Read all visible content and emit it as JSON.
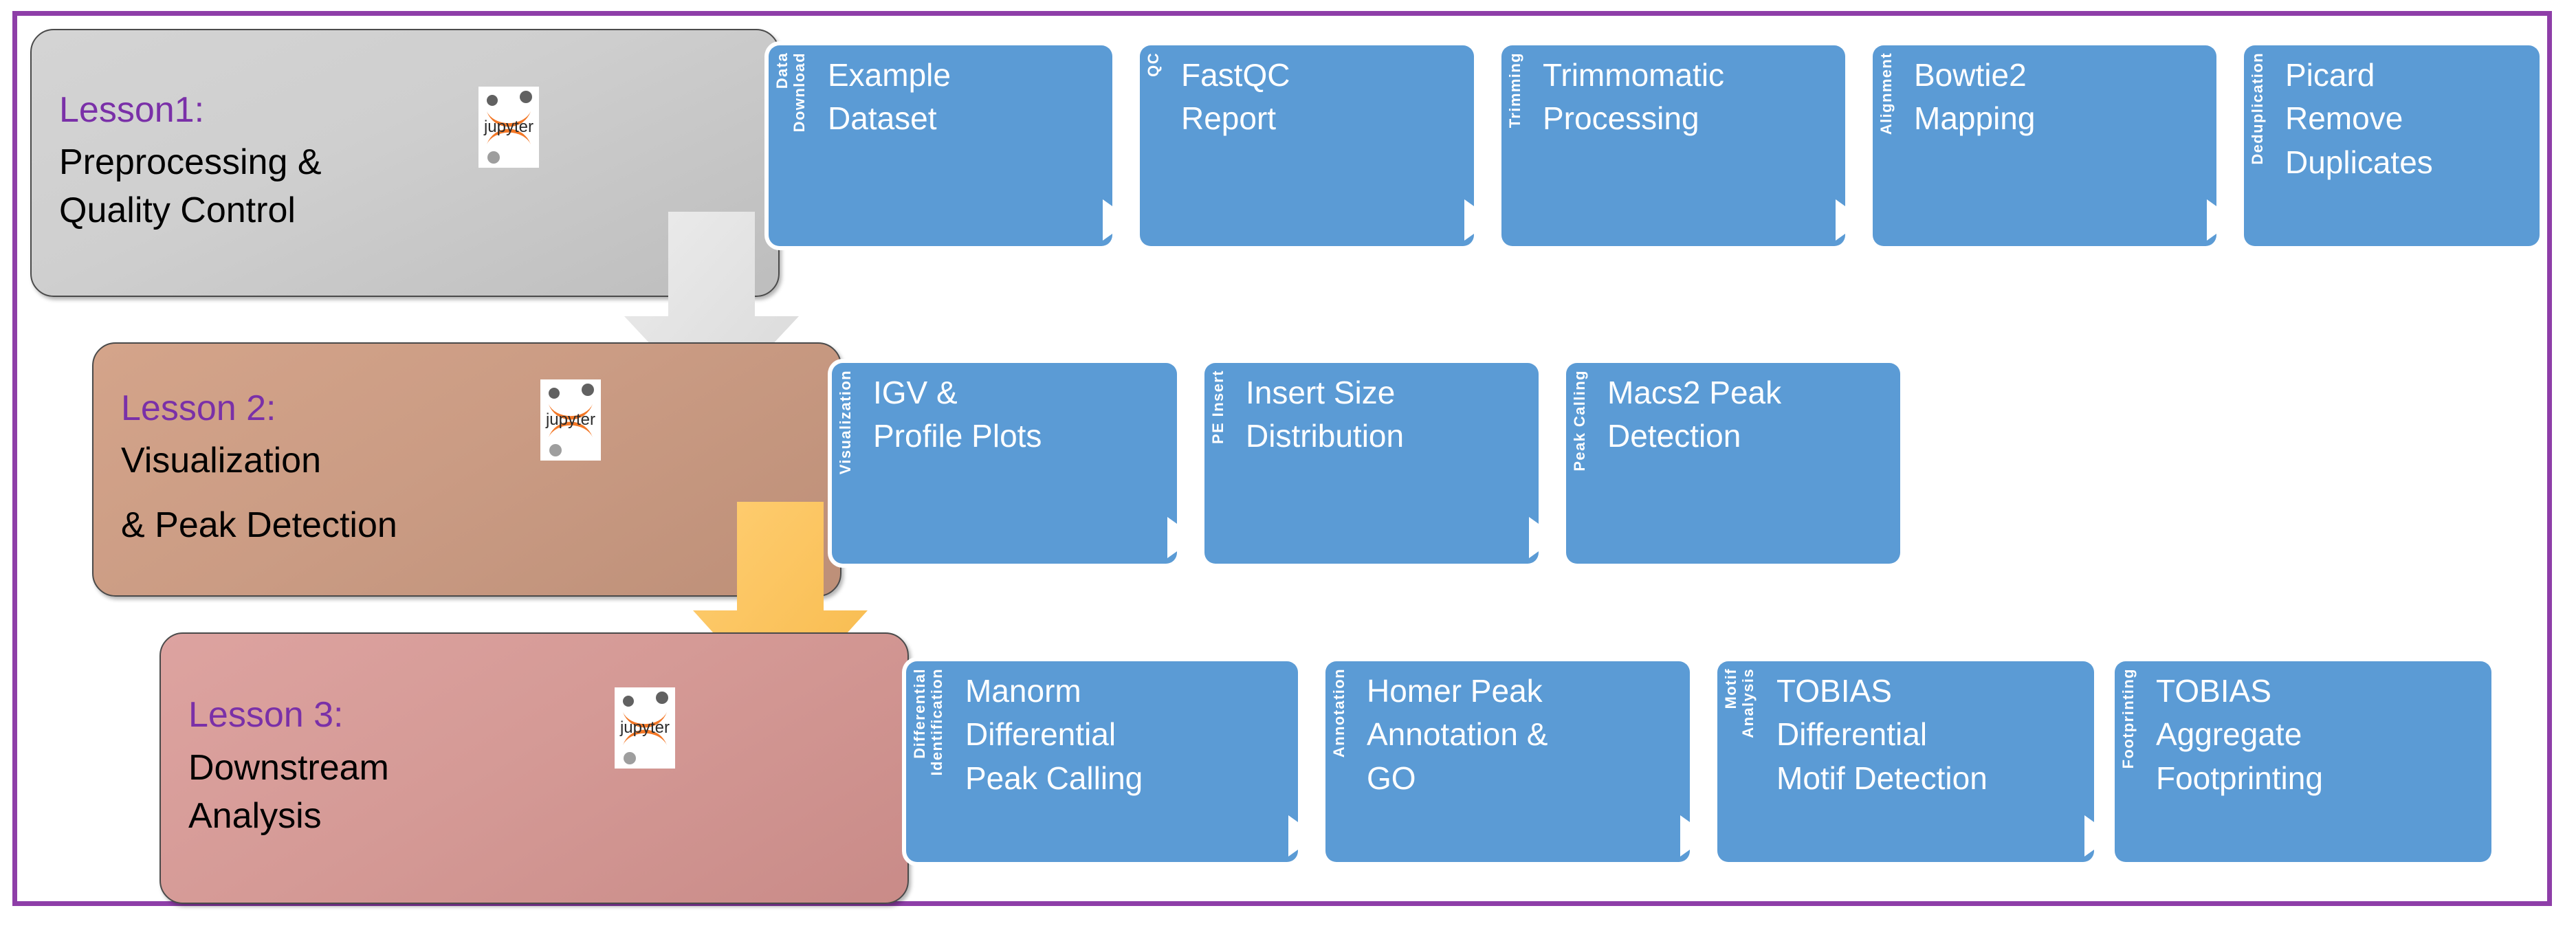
{
  "frame": {
    "border_color": "#8E3EA8"
  },
  "theme": {
    "step_blue": "#5B9BD5",
    "lesson_title_purple": "#7A30A8",
    "lesson1_grey": "#CFCFCF",
    "lesson2_tan": "#CB9C84",
    "lesson3_rose": "#D59A96",
    "arrow_grey": "#E4E4E4",
    "arrow_yellow": "#FBC35E",
    "jupyter_orange": "#F37726"
  },
  "lessons": [
    {
      "id": "lesson-1",
      "title": "Lesson1:",
      "subtitle_lines": [
        "Preprocessing &",
        "Quality Control"
      ],
      "logo": "jupyter-logo",
      "steps": [
        {
          "tab": [
            "Data",
            "Download"
          ],
          "lines": [
            "Example",
            "Dataset"
          ]
        },
        {
          "tab": [
            "QC"
          ],
          "lines": [
            "FastQC",
            "Report"
          ]
        },
        {
          "tab": [
            "Trimming"
          ],
          "lines": [
            "Trimmomatic",
            "Processing"
          ]
        },
        {
          "tab": [
            "Alignment"
          ],
          "lines": [
            "Bowtie2",
            "Mapping"
          ]
        },
        {
          "tab": [
            "Deduplication"
          ],
          "lines": [
            "Picard",
            "Remove",
            "Duplicates"
          ]
        }
      ]
    },
    {
      "id": "lesson-2",
      "title": "Lesson 2:",
      "subtitle_lines": [
        "Visualization",
        "& Peak Detection"
      ],
      "logo": "jupyter-logo",
      "steps": [
        {
          "tab": [
            "Visualization"
          ],
          "lines": [
            "IGV &",
            "Profile Plots"
          ]
        },
        {
          "tab": [
            "PE Insert"
          ],
          "lines": [
            "Insert Size",
            "Distribution"
          ]
        },
        {
          "tab": [
            "Peak Calling"
          ],
          "lines": [
            "Macs2 Peak",
            "Detection"
          ]
        }
      ]
    },
    {
      "id": "lesson-3",
      "title": "Lesson 3:",
      "subtitle_lines": [
        "Downstream",
        "Analysis"
      ],
      "logo": "jupyter-logo",
      "steps": [
        {
          "tab": [
            "Differential",
            "Identification"
          ],
          "lines": [
            "Manorm",
            "Differential",
            "Peak Calling"
          ]
        },
        {
          "tab": [
            "Annotation"
          ],
          "lines": [
            "Homer Peak",
            "Annotation &",
            "GO"
          ]
        },
        {
          "tab": [
            "Motif",
            "Analysis"
          ],
          "lines": [
            "TOBIAS",
            "Differential",
            "Motif Detection"
          ]
        },
        {
          "tab": [
            "Footprinting"
          ],
          "lines": [
            "TOBIAS",
            "Aggregate",
            "Footprinting"
          ]
        }
      ]
    }
  ],
  "flow_arrows": [
    {
      "name": "lesson1-to-lesson2-arrow",
      "color": "#E4E4E4",
      "direction": "down"
    },
    {
      "name": "lesson2-to-lesson3-arrow",
      "color": "#FBC35E",
      "direction": "down"
    }
  ],
  "l1": {
    "title": "Lesson1:",
    "s0": "Preprocessing &",
    "s1": "Quality Control",
    "steps": [
      {
        "t0": "Data",
        "t1": "Download",
        "l0": "Example",
        "l1": "Dataset"
      },
      {
        "t0": "QC",
        "l0": "FastQC",
        "l1": "Report"
      },
      {
        "t0": "Trimming",
        "l0": "Trimmomatic",
        "l1": "Processing"
      },
      {
        "t0": "Alignment",
        "l0": "Bowtie2",
        "l1": "Mapping"
      },
      {
        "t0": "Deduplication",
        "l0": "Picard",
        "l1": "Remove",
        "l2": "Duplicates"
      }
    ]
  },
  "l2": {
    "title": "Lesson 2:",
    "s0": "Visualization",
    "s1": "& Peak Detection",
    "steps": [
      {
        "t0": "Visualization",
        "l0": "IGV &",
        "l1": "Profile Plots"
      },
      {
        "t0": "PE Insert",
        "l0": "Insert Size",
        "l1": "Distribution"
      },
      {
        "t0": "Peak Calling",
        "l0": "Macs2 Peak",
        "l1": "Detection"
      }
    ]
  },
  "l3": {
    "title": "Lesson 3:",
    "s0": "Downstream",
    "s1": "Analysis",
    "steps": [
      {
        "t0": "Differential",
        "t1": "Identification",
        "l0": "Manorm",
        "l1": "Differential",
        "l2": "Peak Calling"
      },
      {
        "t0": "Annotation",
        "l0": "Homer Peak",
        "l1": "Annotation &",
        "l2": "GO"
      },
      {
        "t0": "Motif",
        "t1": "Analysis",
        "l0": "TOBIAS",
        "l1": "Differential",
        "l2": "Motif Detection"
      },
      {
        "t0": "Footprinting",
        "l0": "TOBIAS",
        "l1": "Aggregate",
        "l2": "Footprinting"
      }
    ]
  }
}
